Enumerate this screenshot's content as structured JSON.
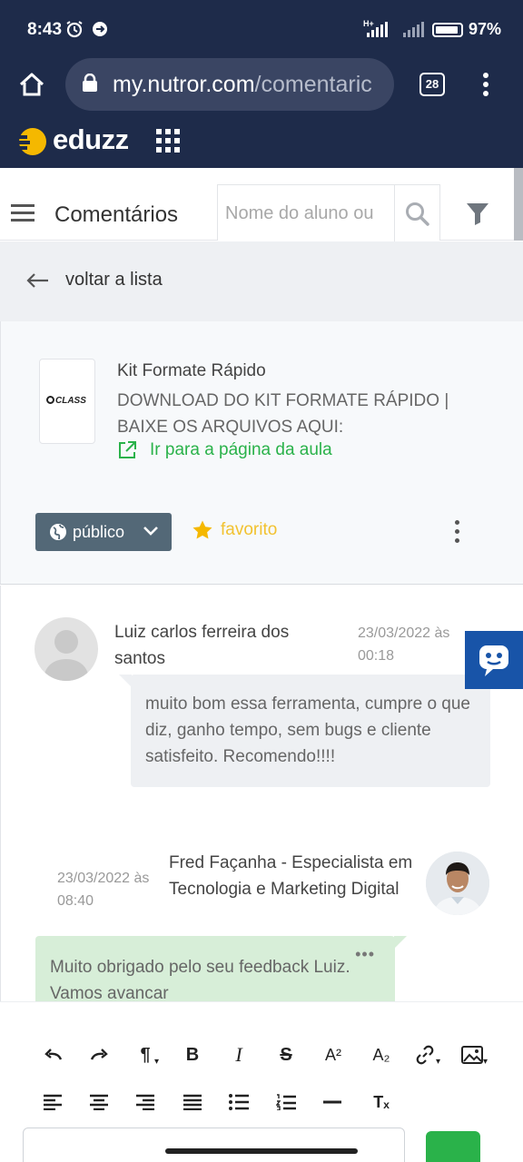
{
  "status_bar": {
    "time": "8:43",
    "network": "H+",
    "battery_pct": "97%",
    "battery_level": 0.97
  },
  "browser": {
    "url_domain": "my.nutror.com",
    "url_path": "/comentaric",
    "tab_count": "28"
  },
  "brand": {
    "name": "eduzz",
    "accent": "#f5b800",
    "header_bg": "#1e2b4a"
  },
  "header": {
    "title": "Comentários",
    "search_placeholder": "Nome do aluno ou"
  },
  "back": {
    "label": "voltar a lista"
  },
  "lesson": {
    "thumb_logo": "CLASS",
    "course": "Kit Formate Rápido",
    "title": "DOWNLOAD DO KIT FORMATE RÁPIDO | BAIXE OS ARQUIVOS AQUI:",
    "link_label": "Ir para a página da aula",
    "visibility": "público",
    "favorite_label": "favorito"
  },
  "comments": [
    {
      "author": "Luiz carlos ferreira dos santos",
      "date": "23/03/2022 às 00:18",
      "text": "muito bom essa ferramenta, cumpre o que diz, ganho tempo, sem bugs e cliente satisfeito. Recomendo!!!!"
    },
    {
      "author": "Fred Façanha - Especialista em Tecnologia e Marketing Digital",
      "date": "23/03/2022 às 08:40",
      "text": "Muito obrigado pelo seu feedback Luiz. Vamos avancar",
      "more": "•••"
    }
  ],
  "editor": {
    "toolbar_row1": [
      "undo-icon",
      "redo-icon",
      "paragraph-icon",
      "bold-icon",
      "italic-icon",
      "strikethrough-icon",
      "superscript-icon",
      "subscript-icon",
      "link-icon",
      "image-icon"
    ],
    "toolbar_row2": [
      "align-left-icon",
      "align-center-icon",
      "align-right-icon",
      "align-justify-icon",
      "bullet-list-icon",
      "numbered-list-icon",
      "horizontal-rule-icon",
      "clear-format-icon"
    ],
    "bold_glyph": "B",
    "italic_glyph": "I",
    "strike_glyph": "S",
    "para_glyph": "¶",
    "sup_glyph": "A²",
    "sub_glyph": "A₂",
    "clear_glyph": "Tₓ"
  }
}
